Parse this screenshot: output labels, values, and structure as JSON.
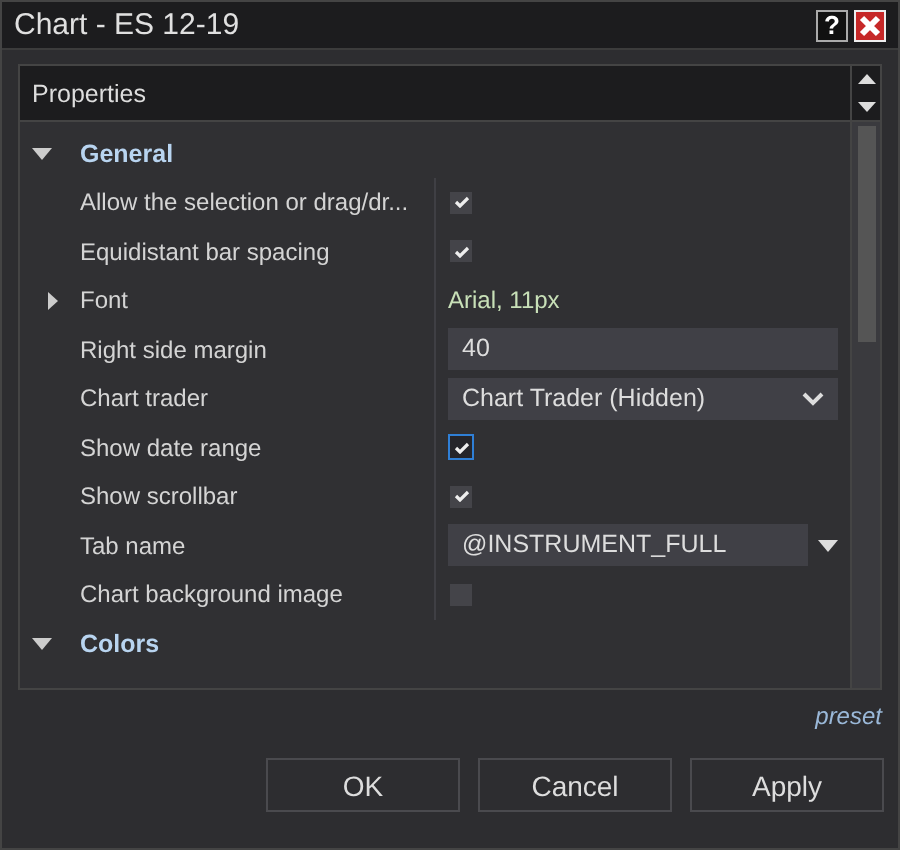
{
  "window": {
    "title": "Chart - ES 12-19",
    "help_icon": "?"
  },
  "panel": {
    "header": "Properties"
  },
  "categories": [
    {
      "name": "General",
      "expanded": true,
      "rows": [
        {
          "kind": "checkbox",
          "label": "Allow the selection or drag/dr...",
          "checked": true,
          "focused": false
        },
        {
          "kind": "checkbox",
          "label": "Equidistant bar spacing",
          "checked": true,
          "focused": false
        },
        {
          "kind": "expander",
          "label": "Font",
          "value": "Arial, 11px",
          "expanded": false
        },
        {
          "kind": "text",
          "label": "Right side margin",
          "value": "40"
        },
        {
          "kind": "dropdown",
          "label": "Chart trader",
          "value": "Chart Trader (Hidden)"
        },
        {
          "kind": "checkbox",
          "label": "Show date range",
          "checked": true,
          "focused": true
        },
        {
          "kind": "checkbox",
          "label": "Show scrollbar",
          "checked": true,
          "focused": false
        },
        {
          "kind": "combo",
          "label": "Tab name",
          "value": "@INSTRUMENT_FULL"
        },
        {
          "kind": "checkbox",
          "label": "Chart background image",
          "checked": false,
          "focused": false
        }
      ]
    },
    {
      "name": "Colors",
      "expanded": true
    }
  ],
  "preset": "preset",
  "buttons": [
    "OK",
    "Cancel",
    "Apply"
  ]
}
